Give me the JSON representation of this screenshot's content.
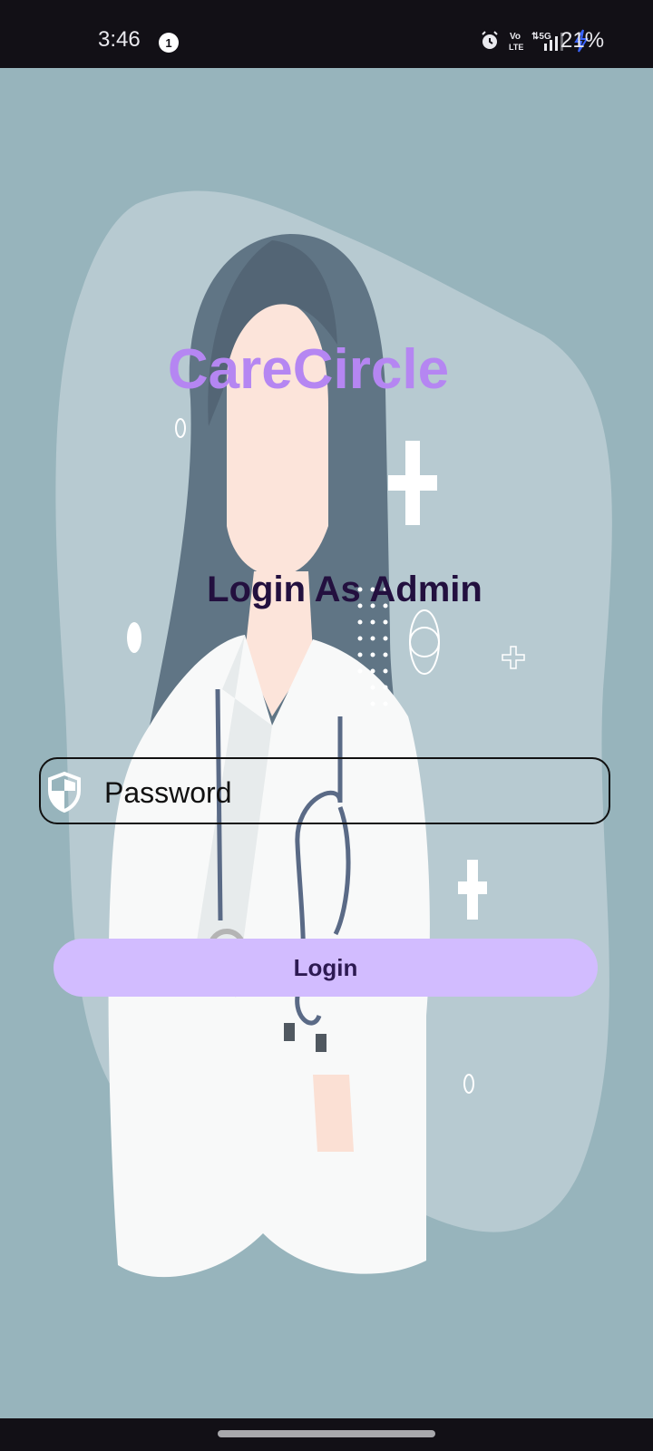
{
  "status_bar": {
    "time": "3:46",
    "notification_count": "1",
    "battery": "21%",
    "icons": [
      "alarm-icon",
      "volte-icon",
      "5g-signal-icon",
      "charging-icon"
    ]
  },
  "app": {
    "title": "CareCircle",
    "heading": "Login As Admin"
  },
  "form": {
    "password_placeholder": "Password",
    "password_value": "",
    "login_label": "Login"
  },
  "colors": {
    "background": "#97b4bc",
    "title": "#b586f2",
    "heading": "#23103f",
    "button": "#d2bcff"
  }
}
